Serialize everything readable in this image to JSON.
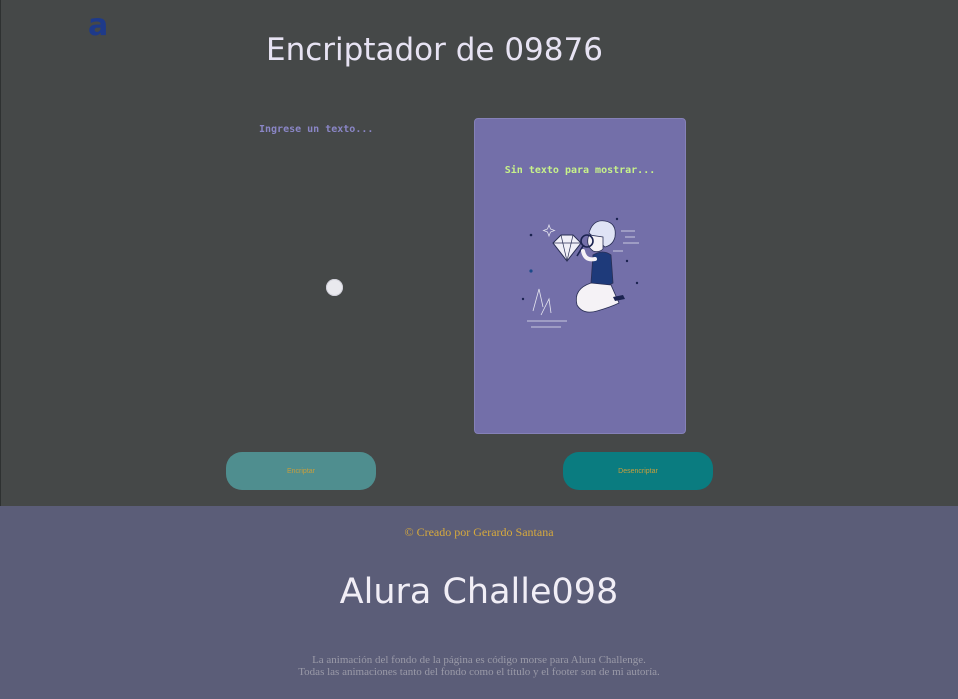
{
  "header": {
    "logo_text": "a",
    "logo_color": "#1e3a8a",
    "title": "Encriptador de 09876"
  },
  "input": {
    "placeholder": "Ingrese un texto...",
    "value": ""
  },
  "output": {
    "empty_message": "Sin texto para mostrar...",
    "illustration": "person-with-magnifier-illustration"
  },
  "buttons": {
    "encrypt_label": "Encriptar",
    "decrypt_label": "Desencriptar"
  },
  "footer": {
    "credit": "© Creado por Gerardo Santana",
    "title": "Alura Challe098",
    "note_line1": "La animación del fondo de la página es código morse para Alura Challenge.",
    "note_line2": "Todas las animaciones tanto del fondo como el título y el footer son de mi autoría."
  },
  "colors": {
    "background": "#454848",
    "card": "#736fa9",
    "footer": "#5b5d78",
    "accent_green": "#c7f28a",
    "button_encrypt": "#4f8e8f",
    "button_decrypt": "#0a7c80"
  }
}
